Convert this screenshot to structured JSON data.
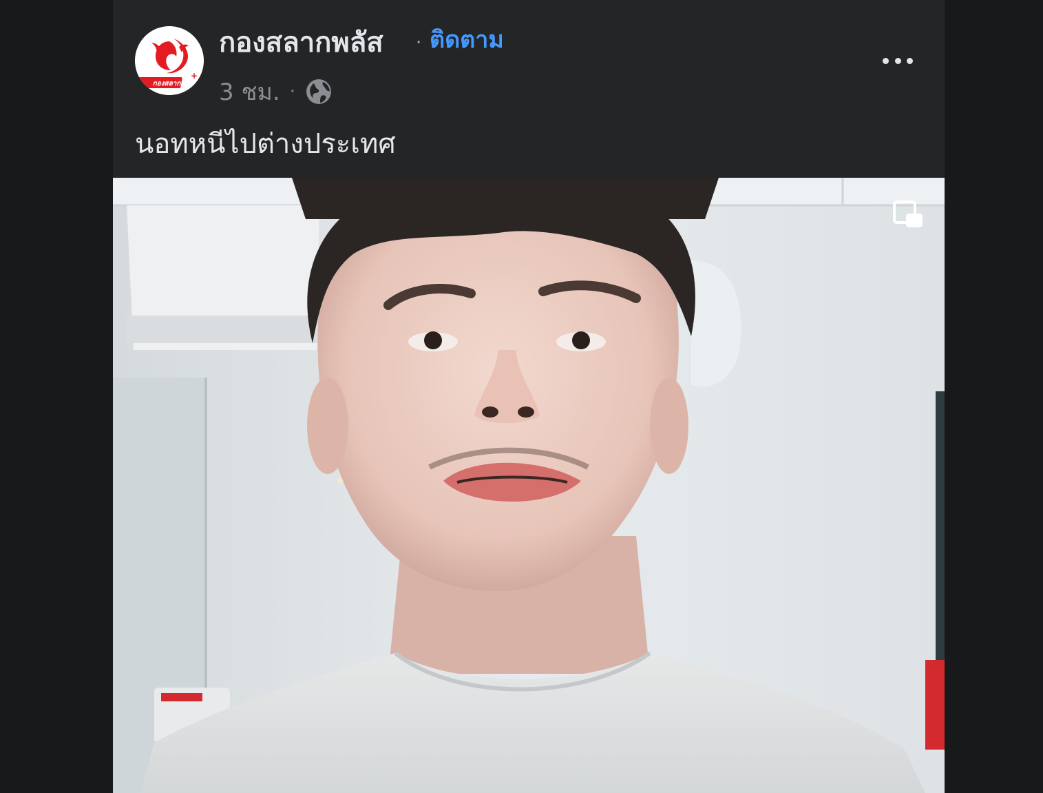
{
  "post": {
    "page_name": "กองสลากพลัส",
    "separator": "·",
    "follow_label": "ติดตาม",
    "timestamp": "3 ชม.",
    "meta_separator": "·",
    "audience_icon": "globe-icon",
    "more_icon": "more-options-icon",
    "caption": "นอทหนีไปต่างประเทศ"
  },
  "avatar": {
    "logo_text": "กองสลาก",
    "brand_color": "#e31b23"
  },
  "video": {
    "pip_icon": "picture-in-picture-icon"
  },
  "colors": {
    "background": "#18191a",
    "card": "#242526",
    "primary_text": "#e4e6eb",
    "secondary_text": "#8a8d91",
    "link": "#4599ff"
  }
}
